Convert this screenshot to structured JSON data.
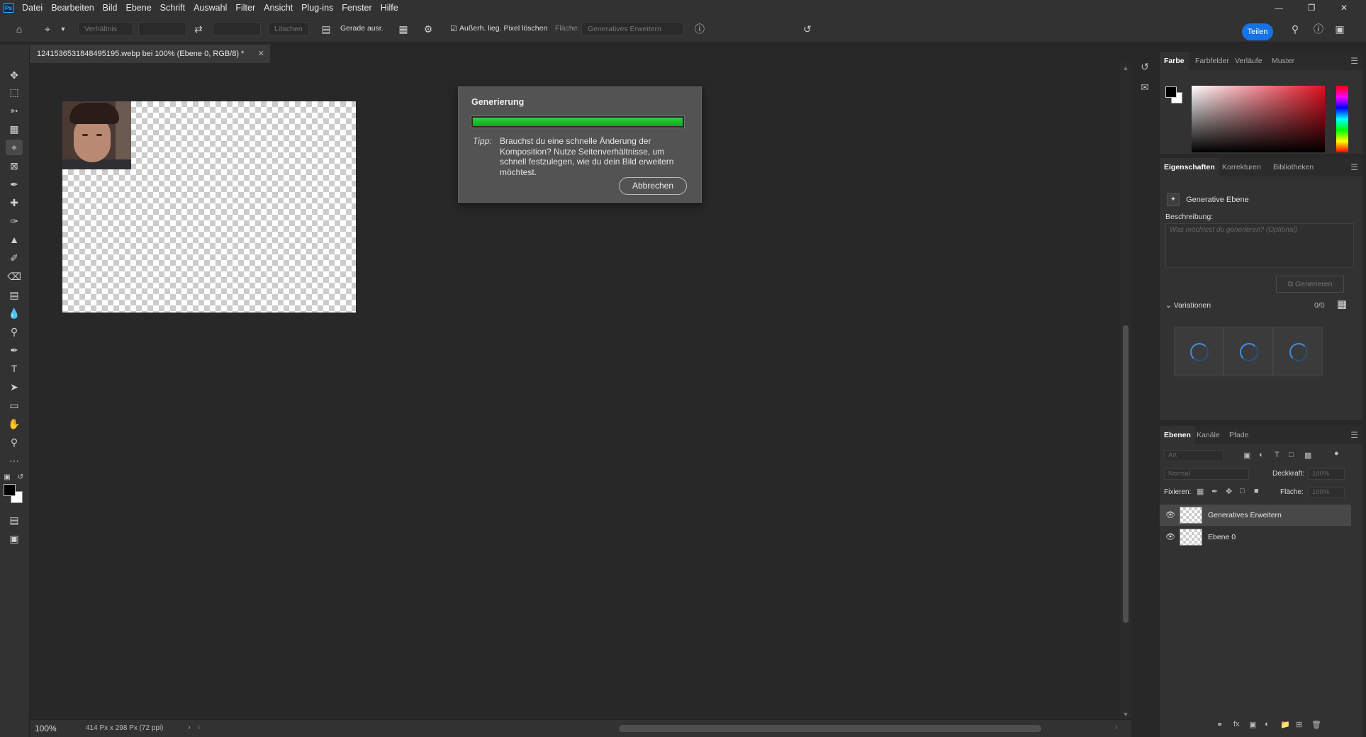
{
  "menu": {
    "logo": "Ps",
    "items": [
      "Datei",
      "Bearbeiten",
      "Bild",
      "Ebene",
      "Schrift",
      "Auswahl",
      "Filter",
      "Ansicht",
      "Plug-ins",
      "Fenster",
      "Hilfe"
    ]
  },
  "options": {
    "ratio_placeholder": "Verhältnis",
    "clear_label": "Löschen",
    "straighten_label": "Gerade ausr.",
    "delete_cropped_label": "Außerh. lieg. Pixel löschen",
    "fill_label": "Fläche:",
    "fill_value": "Generatives Erweitern",
    "share_label": "Teilen"
  },
  "document": {
    "tab_title": "1241536531848495195.webp bei 100% (Ebene 0, RGB/8) *",
    "zoom": "100%",
    "info": "414 Px x 298 Px (72 ppi)"
  },
  "dialog": {
    "title": "Generierung",
    "progress": 1.0,
    "tip_label": "Tipp:",
    "tip_text": "Brauchst du eine schnelle Änderung der Komposition? Nutze Seitenverhältnisse, um schnell festzulegen, wie du dein Bild erweitern möchtest.",
    "cancel_label": "Abbrechen"
  },
  "color_panel": {
    "tabs": [
      "Farbe",
      "Farbfelder",
      "Verläufe",
      "Muster"
    ],
    "foreground": "#000000",
    "background": "#ffffff"
  },
  "properties_panel": {
    "tabs": [
      "Eigenschaften",
      "Korrekturen",
      "Bibliotheken"
    ],
    "layer_type": "Generative Ebene",
    "description_label": "Beschreibung:",
    "description_placeholder": "Was möchtest du generieren? (Optional)",
    "generate_label": "Generieren",
    "variations_label": "Variationen",
    "variations_count": "0/0"
  },
  "layers_panel": {
    "tabs": [
      "Ebenen",
      "Kanäle",
      "Pfade"
    ],
    "filter_placeholder": "Art",
    "blend_mode": "Normal",
    "opacity_label": "Deckkraft:",
    "opacity_value": "100%",
    "lock_label": "Fixieren:",
    "fill_label": "Fläche:",
    "fill_value": "100%",
    "layers": [
      {
        "name": "Generatives Erweitern",
        "selected": true
      },
      {
        "name": "Ebene 0",
        "selected": false
      }
    ]
  },
  "colors": {
    "accent": "#1473e6",
    "progress": "#1fbf35"
  }
}
